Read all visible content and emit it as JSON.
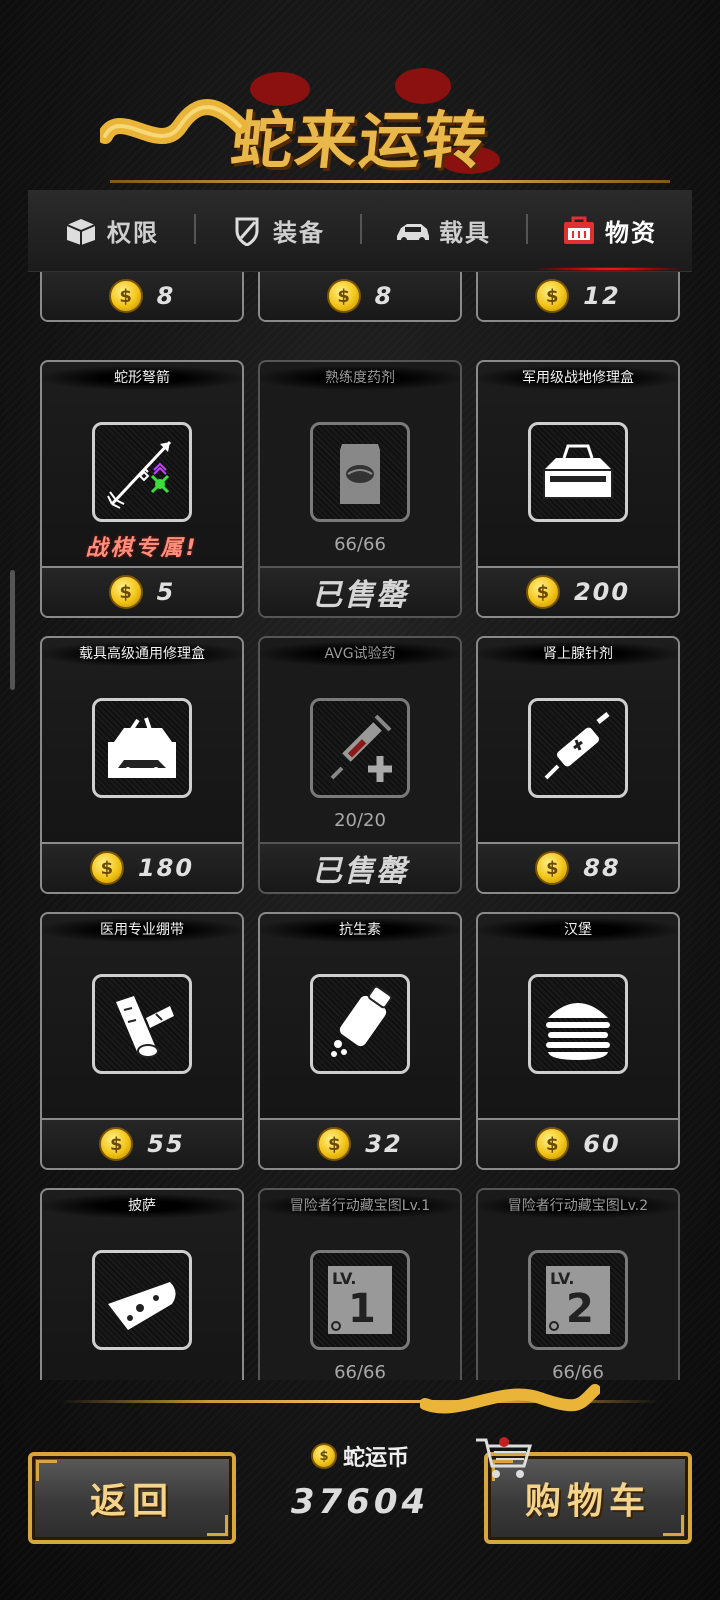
{
  "title": "蛇来运转",
  "tabs": [
    {
      "label": "权限",
      "icon": "box-icon",
      "active": false
    },
    {
      "label": "装备",
      "icon": "shield-icon",
      "active": false
    },
    {
      "label": "载具",
      "icon": "car-icon",
      "active": false
    },
    {
      "label": "物资",
      "icon": "crate-icon",
      "active": true
    }
  ],
  "top_row_prices": [
    "8",
    "8",
    "12"
  ],
  "items": [
    {
      "name": "蛇形弩箭",
      "icon": "crossbow-arrow-icon",
      "tag": "战棋专属!",
      "price": "5",
      "sold": false
    },
    {
      "name": "熟练度药剂",
      "icon": "potion-bag-icon",
      "stock": "66/66",
      "status": "已售罄",
      "sold": true
    },
    {
      "name": "军用级战地修理盒",
      "icon": "toolbox-icon",
      "price": "200",
      "sold": false
    },
    {
      "name": "载具高级通用修理盒",
      "icon": "vehicle-repair-box-icon",
      "price": "180",
      "sold": false
    },
    {
      "name": "AVG试验药",
      "icon": "syringe-icon",
      "stock": "20/20",
      "status": "已售罄",
      "sold": true
    },
    {
      "name": "肾上腺针剂",
      "icon": "injector-icon",
      "price": "88",
      "sold": false
    },
    {
      "name": "医用专业绷带",
      "icon": "bandage-icon",
      "price": "55",
      "sold": false
    },
    {
      "name": "抗生素",
      "icon": "pill-bottle-icon",
      "price": "32",
      "sold": false
    },
    {
      "name": "汉堡",
      "icon": "burger-icon",
      "price": "60",
      "sold": false
    },
    {
      "name": "披萨",
      "icon": "pizza-icon",
      "sold": false
    },
    {
      "name": "冒险者行动藏宝图Lv.1",
      "icon": "treasure-map-lv1-icon",
      "map_level_label": "LV.",
      "map_level": "1",
      "stock": "66/66",
      "sold": true
    },
    {
      "name": "冒险者行动藏宝图Lv.2",
      "icon": "treasure-map-lv2-icon",
      "map_level_label": "LV.",
      "map_level": "2",
      "stock": "66/66",
      "sold": true
    }
  ],
  "currency": {
    "label": "蛇运币",
    "amount": "37604"
  },
  "buttons": {
    "back": "返回",
    "cart": "购物车"
  },
  "colors": {
    "gold": "#d7a73e",
    "coin": "#f2c417",
    "accent_red": "#ff3030",
    "exclusive": "#ff8f7a"
  }
}
